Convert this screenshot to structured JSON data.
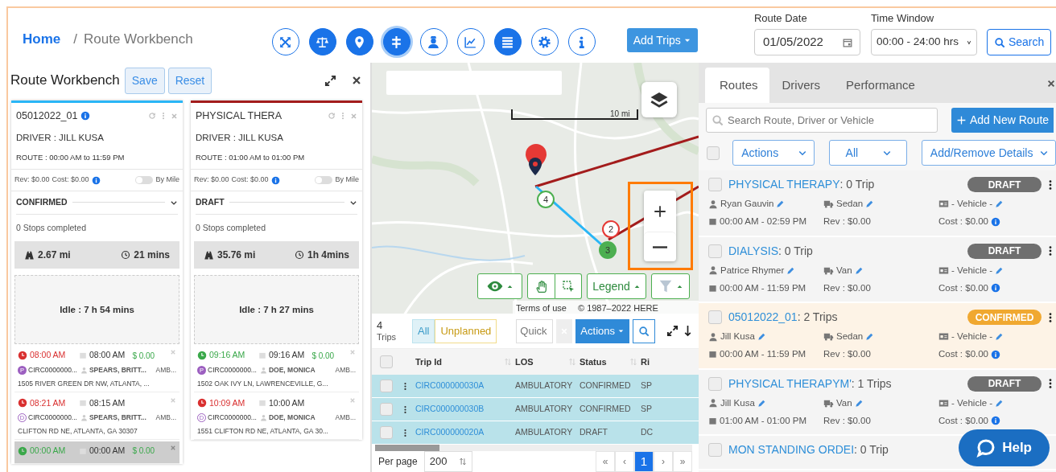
{
  "header": {
    "breadcrumb": {
      "home": "Home",
      "separator": "/",
      "current": "Route Workbench"
    },
    "toolbar_icons": [
      {
        "kind": "expand",
        "on": false,
        "selected": false
      },
      {
        "kind": "scales",
        "on": true,
        "selected": false
      },
      {
        "kind": "pin",
        "on": true,
        "selected": false
      },
      {
        "kind": "signpost",
        "on": true,
        "selected": true
      },
      {
        "kind": "driver",
        "on": false,
        "selected": false
      },
      {
        "kind": "chart",
        "on": false,
        "selected": false
      },
      {
        "kind": "list",
        "on": true,
        "selected": false
      },
      {
        "kind": "gear",
        "on": false,
        "selected": false
      },
      {
        "kind": "info",
        "on": false,
        "selected": false
      }
    ],
    "add_trips": "Add Trips",
    "route_date": {
      "label": "Route Date",
      "value": "01/05/2022"
    },
    "time_window": {
      "label": "Time Window",
      "value": "00:00 - 24:00 hrs"
    },
    "search": "Search"
  },
  "workbench": {
    "title": "Route Workbench",
    "save": "Save",
    "reset": "Reset",
    "cards": [
      {
        "title": "05012022_01",
        "info_icon": true,
        "color": "#29b6f6",
        "driver": "DRIVER : JILL KUSA",
        "route": "ROUTE : 00:00 AM to 11:59 PM",
        "rev": "Rev: $0.00",
        "cost": "Cost: $0.00",
        "by_mile": {
          "label": "By Mile",
          "on": false
        },
        "status": "CONFIRMED",
        "stops_completed": "0 Stops completed",
        "distance": "2.67 mi",
        "duration": "21 mins",
        "idle": "Idle : 7 h 54 mins",
        "stops": [
          {
            "eta": "08:00 AM",
            "on_time": false,
            "scheduled": "08:00 AM",
            "price": "$ 0.00",
            "kind": "pickup",
            "type": "P",
            "trip": "CIRC0000000...",
            "rider": "SPEARS, BRITT...",
            "los": "AMB...",
            "address": "1505 RIVER GREEN DR NW, ATLANTA, ...",
            "selected": false
          },
          {
            "eta": "08:21 AM",
            "on_time": false,
            "scheduled": "08:15 AM",
            "kind": "dropoff",
            "type": "D",
            "trip": "CIRC0000000...",
            "rider": "SPEARS, BRITT...",
            "los": "AMB...",
            "address": "CLIFTON RD NE, ATLANTA, GA 30307",
            "selected": false
          },
          {
            "eta": "00:00 AM",
            "on_time": true,
            "scheduled": "00:00 AM",
            "price": "$ 0.00",
            "selected": true
          }
        ]
      },
      {
        "title": "PHYSICAL THERA",
        "info_icon": false,
        "color": "#a31c1c",
        "driver": "DRIVER : JILL KUSA",
        "route": "ROUTE : 01:00 AM to 01:00 PM",
        "rev": "Rev: $0.00",
        "cost": "Cost: $0.00",
        "by_mile": {
          "label": "By Mile",
          "on": false
        },
        "status": "DRAFT",
        "stops_completed": "0 Stops completed",
        "distance": "35.76 mi",
        "duration": "1h 4mins",
        "idle": "Idle : 7 h 27 mins",
        "stops": [
          {
            "eta": "09:16 AM",
            "on_time": true,
            "scheduled": "09:16 AM",
            "price": "$ 0.00",
            "kind": "pickup",
            "type": "P",
            "trip": "CIRC0000000...",
            "rider": "DOE, MONICA",
            "los": "AMB...",
            "address": "1502 OAK IVY LN, LAWRENCEVILLE, G...",
            "selected": false
          },
          {
            "eta": "10:09 AM",
            "on_time": false,
            "scheduled": "10:00 AM",
            "kind": "dropoff",
            "type": "D",
            "trip": "CIRC0000000...",
            "rider": "DOE, MONICA",
            "los": "AMB...",
            "address": "1551 CLIFTON RD NE, ATLANTA, GA 30...",
            "selected": false
          }
        ]
      }
    ]
  },
  "map": {
    "scale_label": "10 mi",
    "markers": [
      {
        "label": "4",
        "kind": "ring",
        "color": "#4caf50"
      },
      {
        "label": "2",
        "kind": "ring",
        "color": "#e53935"
      },
      {
        "label": "3",
        "kind": "solid",
        "color": "#4caf50"
      }
    ],
    "legend": "Legend",
    "terms": "Terms of use",
    "copyright": "© 1987–2022 HERE"
  },
  "trips": {
    "count": "4",
    "count_label": "Trips",
    "filters": [
      {
        "label": "All",
        "selected": true
      },
      {
        "label": "Unplanned",
        "selected": false
      }
    ],
    "quick_placeholder": "Quick",
    "actions": "Actions",
    "select_all_checked": false,
    "columns": [
      "Trip Id",
      "LOS",
      "Status",
      "Ri"
    ],
    "rows": [
      {
        "trip_id": "CIRC000000030A",
        "los": "AMBULATORY",
        "status": "CONFIRMED",
        "column_4": "SP",
        "selected": true
      },
      {
        "trip_id": "CIRC000000030B",
        "los": "AMBULATORY",
        "status": "CONFIRMED",
        "column_4": "SP",
        "selected": true
      },
      {
        "trip_id": "CIRC000000020A",
        "los": "AMBULATORY",
        "status": "DRAFT",
        "column_4": "DC",
        "selected": true
      }
    ],
    "per_page_label": "Per page",
    "per_page": "200",
    "pages": [
      {
        "label": "«",
        "selected": false
      },
      {
        "label": "‹",
        "selected": false
      },
      {
        "label": "1",
        "selected": true
      },
      {
        "label": "›",
        "selected": false
      },
      {
        "label": "»",
        "selected": false
      }
    ]
  },
  "routes_panel": {
    "tabs": [
      {
        "label": "Routes",
        "selected": true
      },
      {
        "label": "Drivers",
        "selected": false
      },
      {
        "label": "Performance",
        "selected": false
      }
    ],
    "search_placeholder": "Search Route, Driver or Vehicle",
    "add_route": "Add New Route",
    "filters": [
      "Actions",
      "All",
      "Add/Remove Details"
    ],
    "select_all_checked": false,
    "routes": [
      {
        "name": "PHYSICAL THERAPY",
        "trips": ": 0 Trip",
        "status": "DRAFT",
        "kind": "draft",
        "selected": false,
        "driver": "Ryan Gauvin",
        "vehicle_type": "Sedan",
        "vehicle": "- Vehicle -",
        "time": "00:00 AM - 02:59 PM",
        "rev": "Rev : $0.00",
        "cost": "Cost : $0.00"
      },
      {
        "name": "DIALYSIS",
        "trips": ": 0 Trip",
        "status": "DRAFT",
        "kind": "draft",
        "selected": false,
        "driver": "Patrice Rhymer",
        "vehicle_type": "Van",
        "vehicle": "- Vehicle -",
        "time": "00:00 AM - 11:59 PM",
        "rev": "Rev : $0.00",
        "cost": "Cost : $0.00"
      },
      {
        "name": "05012022_01",
        "trips": ": 2 Trips",
        "status": "CONFIRMED",
        "kind": "confirmed",
        "selected": true,
        "driver": "Jill Kusa",
        "vehicle_type": "Sedan",
        "vehicle": "- Vehicle -",
        "time": "00:00 AM - 11:59 PM",
        "rev": "Rev : $0.00",
        "cost": "Cost : $0.00"
      },
      {
        "name": "PHYSICAL THERAPYM'",
        "trips": ": 1 Trips",
        "status": "DRAFT",
        "kind": "draft",
        "selected": false,
        "driver": "Jill Kusa",
        "vehicle_type": "Van",
        "vehicle": "- Vehicle -",
        "time": "01:00 AM - 01:00 PM",
        "rev": "Rev : $0.00",
        "cost": "Cost : $0.00"
      },
      {
        "name": "MON STANDING ORDEI",
        "trips": ": 0 Trip",
        "selected": false
      }
    ],
    "help": "Help"
  }
}
